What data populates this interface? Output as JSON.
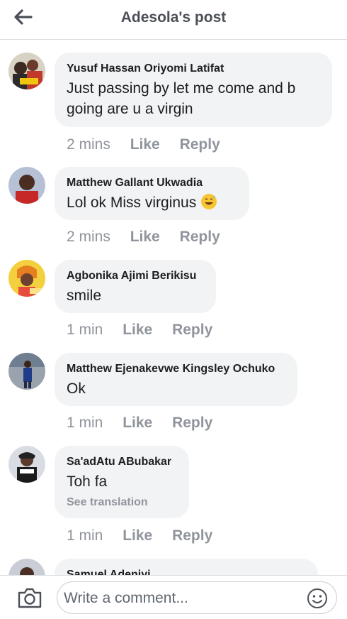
{
  "header": {
    "title": "Adesola's post"
  },
  "comments": [
    {
      "name": "Yusuf Hassan Oriyomi Latifat",
      "text": "Just passing by let me come and b going are u a virgin",
      "time": "2 mins",
      "like": "Like",
      "reply": "Reply"
    },
    {
      "name": "Matthew Gallant Ukwadia",
      "text": "Lol ok Miss virginus",
      "time": "2 mins",
      "like": "Like",
      "reply": "Reply",
      "emoji": "grinning-sweat-emoji"
    },
    {
      "name": "Agbonika Ajimi Berikisu",
      "text": "smile",
      "time": "1 min",
      "like": "Like",
      "reply": "Reply"
    },
    {
      "name": "Matthew Ejenakevwe Kingsley Ochuko",
      "text": "Ok",
      "time": "1 min",
      "like": "Like",
      "reply": "Reply"
    },
    {
      "name": "Sa'adAtu ABubakar",
      "text": "Toh fa",
      "see_translation": "See translation",
      "time": "1 min",
      "like": "Like",
      "reply": "Reply"
    },
    {
      "name": "Samuel Adeniyi"
    }
  ],
  "footer": {
    "placeholder": "Write a comment..."
  },
  "colors": {
    "meta": "#90949c",
    "bubble": "#f2f3f5",
    "header_text": "#4b4f56"
  }
}
